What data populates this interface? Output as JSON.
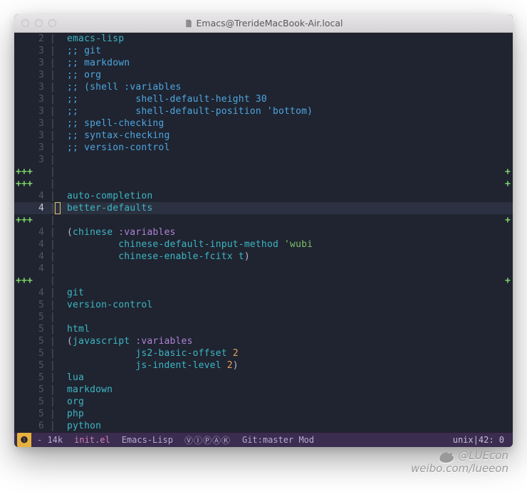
{
  "window": {
    "title": "Emacs@TrerideMacBook-Air.local"
  },
  "lines": [
    {
      "gutter": "2",
      "kind": "norm",
      "segments": [
        {
          "c": "kw",
          "t": "emacs-lisp"
        }
      ]
    },
    {
      "gutter": "3",
      "kind": "norm",
      "segments": [
        {
          "c": "cm",
          "t": ";; git"
        }
      ]
    },
    {
      "gutter": "3",
      "kind": "norm",
      "segments": [
        {
          "c": "cm",
          "t": ";; markdown"
        }
      ]
    },
    {
      "gutter": "3",
      "kind": "norm",
      "segments": [
        {
          "c": "cm",
          "t": ";; org"
        }
      ]
    },
    {
      "gutter": "3",
      "kind": "norm",
      "segments": [
        {
          "c": "cm",
          "t": ";; (shell :variables"
        }
      ]
    },
    {
      "gutter": "3",
      "kind": "norm",
      "segments": [
        {
          "c": "cm",
          "t": ";;          shell-default-height 30"
        }
      ]
    },
    {
      "gutter": "3",
      "kind": "norm",
      "segments": [
        {
          "c": "cm",
          "t": ";;          shell-default-position 'bottom)"
        }
      ]
    },
    {
      "gutter": "3",
      "kind": "norm",
      "segments": [
        {
          "c": "cm",
          "t": ";; spell-checking"
        }
      ]
    },
    {
      "gutter": "3",
      "kind": "norm",
      "segments": [
        {
          "c": "cm",
          "t": ";; syntax-checking"
        }
      ]
    },
    {
      "gutter": "3",
      "kind": "norm",
      "segments": [
        {
          "c": "cm",
          "t": ";; version-control"
        }
      ]
    },
    {
      "gutter": "3",
      "kind": "norm",
      "segments": []
    },
    {
      "gutter": "+++",
      "kind": "plus",
      "segments": [],
      "endplus": true
    },
    {
      "gutter": "+++",
      "kind": "plus",
      "segments": [],
      "endplus": true
    },
    {
      "gutter": "4",
      "kind": "norm",
      "segments": [
        {
          "c": "kw",
          "t": "auto-completion"
        }
      ]
    },
    {
      "gutter": "4",
      "kind": "curr",
      "segments": [
        {
          "c": "kw",
          "t": "better-defaults"
        }
      ]
    },
    {
      "gutter": "+++",
      "kind": "plus",
      "segments": [],
      "endplus": true
    },
    {
      "gutter": "4",
      "kind": "norm",
      "segments": [
        {
          "c": "punc",
          "t": "("
        },
        {
          "c": "kw",
          "t": "chinese"
        },
        {
          "c": "",
          "t": " "
        },
        {
          "c": "key",
          "t": ":variables"
        }
      ]
    },
    {
      "gutter": "4",
      "kind": "norm",
      "segments": [
        {
          "c": "",
          "t": "         "
        },
        {
          "c": "kw",
          "t": "chinese-default-input-method"
        },
        {
          "c": "",
          "t": " "
        },
        {
          "c": "str",
          "t": "'wubi"
        }
      ]
    },
    {
      "gutter": "4",
      "kind": "norm",
      "segments": [
        {
          "c": "",
          "t": "         "
        },
        {
          "c": "kw",
          "t": "chinese-enable-fcitx"
        },
        {
          "c": "",
          "t": " "
        },
        {
          "c": "kw",
          "t": "t"
        },
        {
          "c": "punc",
          "t": ")"
        }
      ]
    },
    {
      "gutter": "4",
      "kind": "norm",
      "segments": []
    },
    {
      "gutter": "+++",
      "kind": "plus",
      "segments": [],
      "endplus": true
    },
    {
      "gutter": "4",
      "kind": "norm",
      "segments": [
        {
          "c": "kw",
          "t": "git"
        }
      ]
    },
    {
      "gutter": "5",
      "kind": "norm",
      "segments": [
        {
          "c": "kw",
          "t": "version-control"
        }
      ]
    },
    {
      "gutter": "5",
      "kind": "norm",
      "segments": []
    },
    {
      "gutter": "5",
      "kind": "norm",
      "segments": [
        {
          "c": "kw",
          "t": "html"
        }
      ]
    },
    {
      "gutter": "5",
      "kind": "norm",
      "segments": [
        {
          "c": "punc",
          "t": "("
        },
        {
          "c": "kw",
          "t": "javascript"
        },
        {
          "c": "",
          "t": " "
        },
        {
          "c": "key",
          "t": ":variables"
        }
      ]
    },
    {
      "gutter": "5",
      "kind": "norm",
      "segments": [
        {
          "c": "",
          "t": "            "
        },
        {
          "c": "kw",
          "t": "js2-basic-offset"
        },
        {
          "c": "",
          "t": " "
        },
        {
          "c": "num",
          "t": "2"
        }
      ]
    },
    {
      "gutter": "5",
      "kind": "norm",
      "segments": [
        {
          "c": "",
          "t": "            "
        },
        {
          "c": "kw",
          "t": "js-indent-level"
        },
        {
          "c": "",
          "t": " "
        },
        {
          "c": "num",
          "t": "2"
        },
        {
          "c": "punc",
          "t": ")"
        }
      ]
    },
    {
      "gutter": "5",
      "kind": "norm",
      "segments": [
        {
          "c": "kw",
          "t": "lua"
        }
      ]
    },
    {
      "gutter": "5",
      "kind": "norm",
      "segments": [
        {
          "c": "kw",
          "t": "markdown"
        }
      ]
    },
    {
      "gutter": "5",
      "kind": "norm",
      "segments": [
        {
          "c": "kw",
          "t": "org"
        }
      ]
    },
    {
      "gutter": "5",
      "kind": "norm",
      "segments": [
        {
          "c": "kw",
          "t": "php"
        }
      ]
    },
    {
      "gutter": "6",
      "kind": "norm",
      "segments": [
        {
          "c": "kw",
          "t": "python"
        }
      ]
    }
  ],
  "modeline": {
    "warn_icon": "❶",
    "size": "- 14k",
    "filename": "init.el",
    "major_mode": "Emacs-Lisp",
    "flycheck": "ⓋⒾⓅⒶⓀ",
    "vc": "Git:master Mod",
    "coding": "unix",
    "position": "42: 0"
  },
  "watermark": {
    "handle": "@LUEcon",
    "url": "weibo.com/lueeon"
  }
}
